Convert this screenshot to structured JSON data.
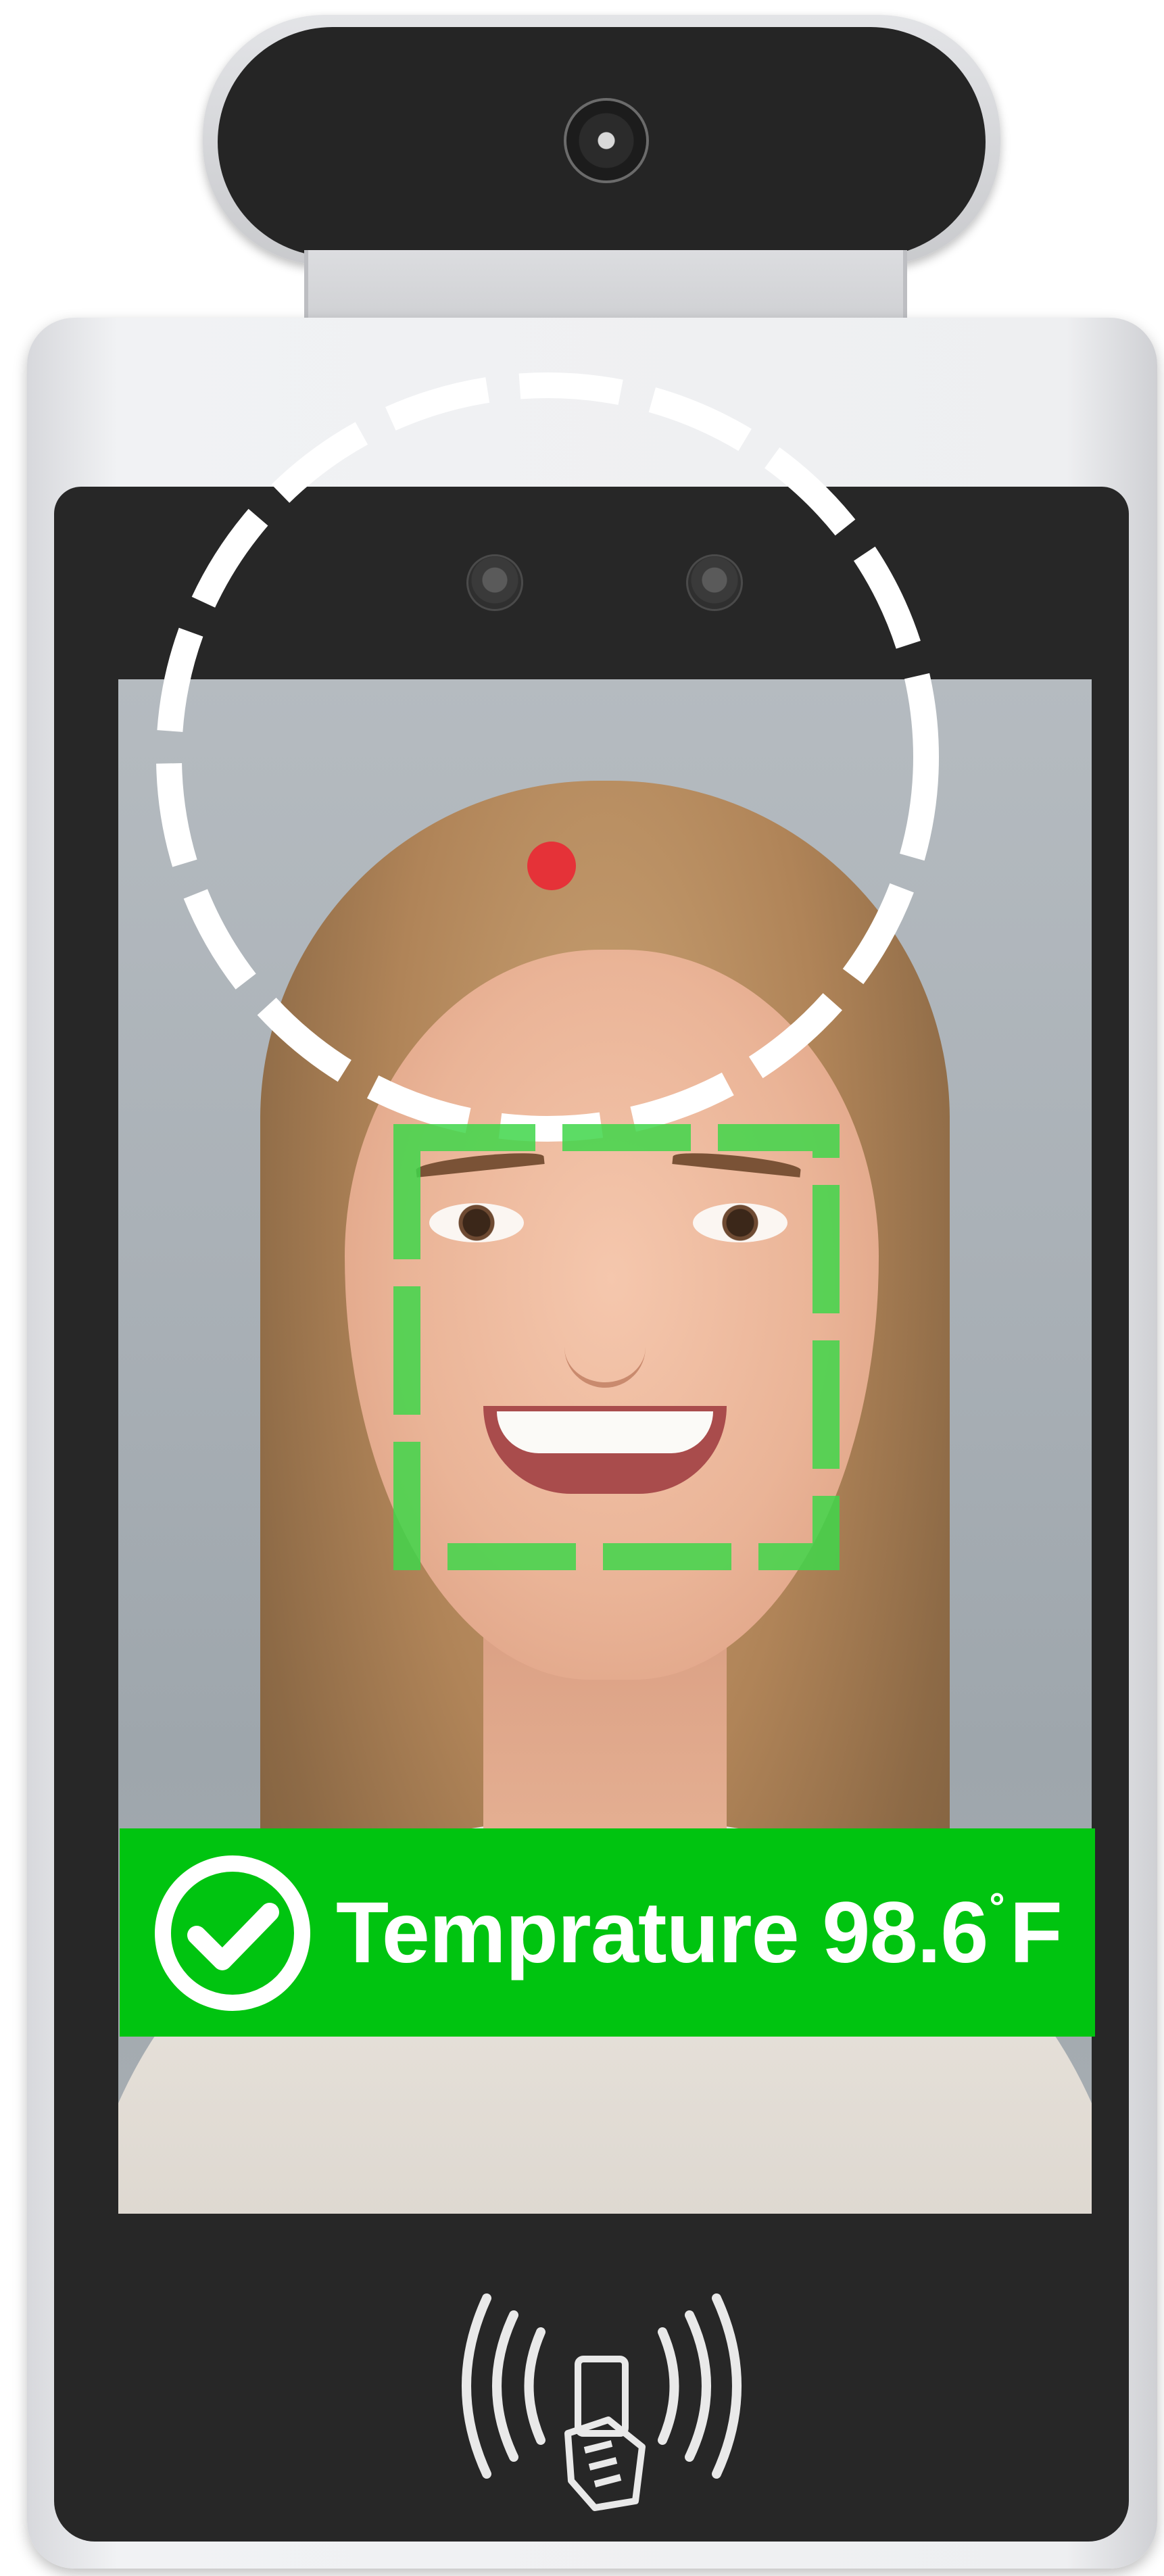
{
  "device": {
    "screen": {
      "status_banner": {
        "label": "Temprature",
        "value": "98.6",
        "degree_symbol": "°",
        "unit": "F",
        "state": "pass",
        "background_color": "#00c410",
        "icon": "check-circle-icon"
      },
      "overlays": {
        "face_circle_color": "#ffffff",
        "face_box_color": "#3fd64a",
        "target_dot_color": "#e53238"
      }
    },
    "icons": {
      "camera": "camera-lens-icon",
      "ir_sensors": "ir-sensor-icon",
      "nfc": "nfc-contactless-icon"
    }
  }
}
